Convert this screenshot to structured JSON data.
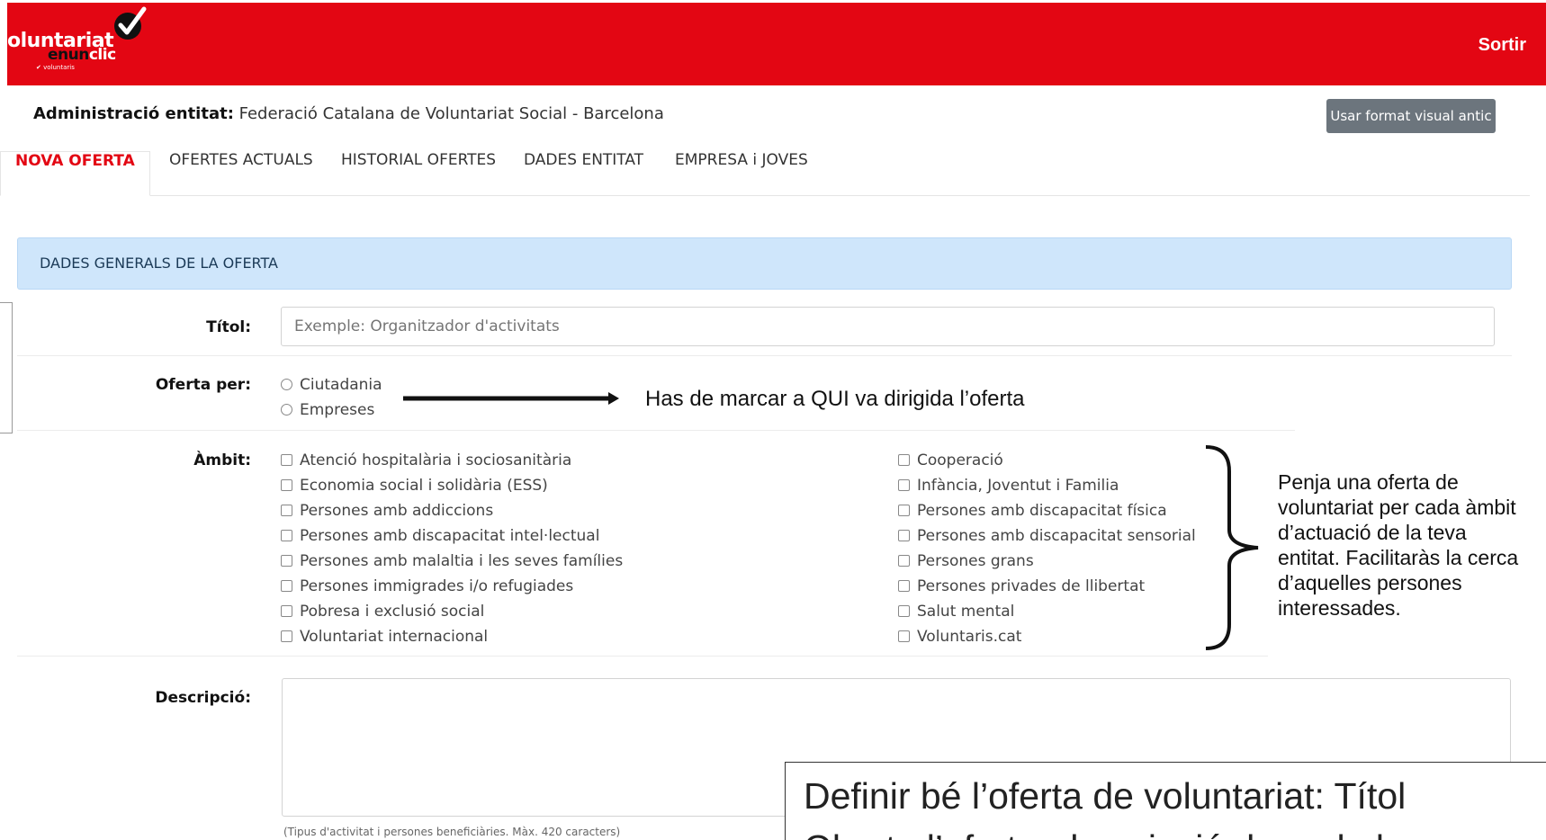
{
  "header": {
    "logo_main": "oluntariat",
    "logo_en": "en",
    "logo_un": "un",
    "logo_clic": "clic",
    "logo_sub": "voluntaris",
    "logout_label": "Sortir",
    "brand_color": "#e30613"
  },
  "entity": {
    "label": "Administració entitat:",
    "name": " Federació Catalana de Voluntariat Social - Barcelona",
    "old_format_button": "Usar format visual antic"
  },
  "tabs": [
    {
      "label": "NOVA OFERTA",
      "active": true
    },
    {
      "label": "OFERTES ACTUALS",
      "active": false
    },
    {
      "label": "HISTORIAL OFERTES",
      "active": false
    },
    {
      "label": "DADES ENTITAT",
      "active": false
    },
    {
      "label": "EMPRESA i JOVES",
      "active": false
    }
  ],
  "panel": {
    "title": "DADES GENERALS DE LA OFERTA"
  },
  "form": {
    "title_label": "Títol:",
    "title_placeholder": "Exemple: Organitzador d'activitats",
    "offer_for_label": "Oferta per:",
    "offer_for_options": [
      "Ciutadania",
      "Empreses"
    ],
    "ambit_label": "Àmbit:",
    "ambit_col1": [
      "Atenció hospitalària i sociosanitària",
      "Economia social i solidària (ESS)",
      "Persones amb addiccions",
      "Persones amb discapacitat intel·lectual",
      "Persones amb malaltia i les seves famílies",
      "Persones immigrades i/o refugiades",
      "Pobresa i exclusió social",
      "Voluntariat internacional"
    ],
    "ambit_col2": [
      "Cooperació",
      "Infància, Joventut i Familia",
      "Persones amb discapacitat física",
      "Persones amb discapacitat sensorial",
      "Persones grans",
      "Persones privades de llibertat",
      "Salut mental",
      "Voluntaris.cat"
    ],
    "description_label": "Descripció:",
    "description_hint": "(Tipus d'activitat i persones beneficiàries. Màx. 420 caracters)"
  },
  "annotations": {
    "offer_for_note": "Has de marcar a QUI va dirigida l’oferta",
    "ambit_note": [
      "Penja una oferta de",
      "voluntariat per cada àmbit",
      "d’actuació de la teva",
      "entitat. Facilitaràs la cerca",
      "d’aquelles persones",
      "interessades."
    ],
    "description_note_line1": "Definir bé l’oferta de voluntariat: Títol",
    "description_note_line2": "Oberta l’oferta, descripció de cada le"
  }
}
